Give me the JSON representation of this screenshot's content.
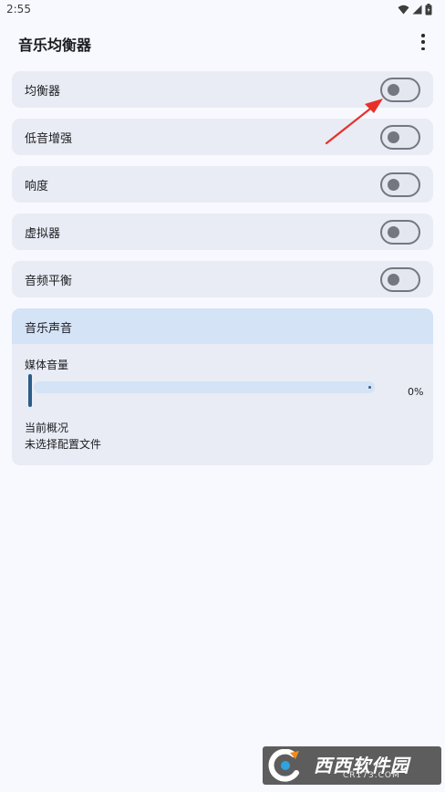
{
  "status_bar": {
    "time": "2:55",
    "icons": [
      "wifi-icon",
      "signal-icon",
      "battery-icon"
    ]
  },
  "app_bar": {
    "title": "音乐均衡器",
    "menu_icon": "more-vert-icon"
  },
  "settings": [
    {
      "label": "均衡器",
      "enabled": false
    },
    {
      "label": "低音增强",
      "enabled": false
    },
    {
      "label": "响度",
      "enabled": false
    },
    {
      "label": "虚拟器",
      "enabled": false
    },
    {
      "label": "音频平衡",
      "enabled": false
    }
  ],
  "music_card": {
    "title": "音乐声音",
    "media_volume_label": "媒体音量",
    "media_volume_value": "0%",
    "media_volume_fraction": 0,
    "profile_label": "当前概况",
    "profile_value": "未选择配置文件"
  },
  "colors": {
    "background": "#f8f9ff",
    "row_background": "#e9ecf4",
    "card_header": "#d4e3f6",
    "toggle_outline": "#74777f",
    "slider_handle": "#2c5d8a",
    "annotation_arrow": "#e8302a"
  },
  "watermark": {
    "brand": "西西软件园",
    "site": "CR173.COM"
  }
}
